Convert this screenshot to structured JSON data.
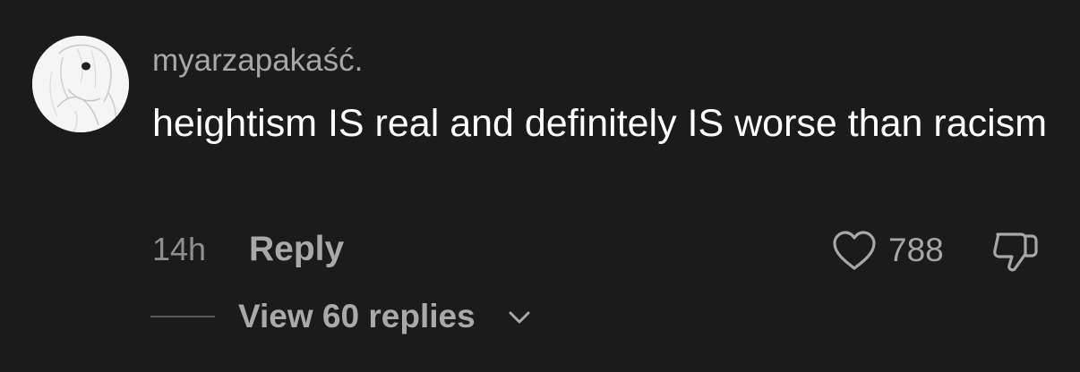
{
  "comment": {
    "username": "myarzapakaść.",
    "text": "heightism IS real and definitely IS worse than racism",
    "timestamp": "14h",
    "reply_label": "Reply",
    "like_count": "788",
    "view_replies_label": "View 60 replies"
  },
  "icons": {
    "like": "heart-icon",
    "dislike": "thumbs-down-icon",
    "expand": "chevron-down-icon"
  },
  "colors": {
    "background": "#1b1b1b",
    "primary_text": "#ffffff",
    "secondary_text": "#a7a7a7"
  }
}
